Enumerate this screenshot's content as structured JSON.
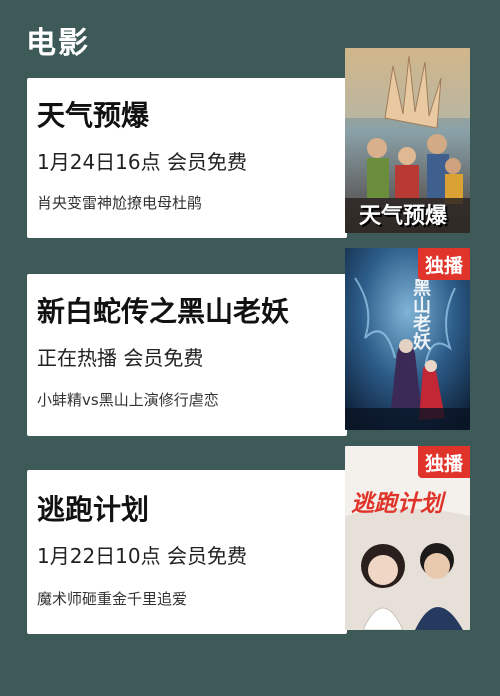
{
  "section": {
    "title": "电影"
  },
  "movies": [
    {
      "title": "天气预爆",
      "schedule": "1月24日16点  会员免费",
      "description": "肖央变雷神尬撩电母杜鹃",
      "poster_text": "天气预爆",
      "badge": ""
    },
    {
      "title": "新白蛇传之黑山老妖",
      "schedule": "正在热播  会员免费",
      "description": "小蚌精vs黑山上演修行虐恋",
      "poster_text": "黑山老妖",
      "badge": "独播"
    },
    {
      "title": "逃跑计划",
      "schedule": "1月22日10点  会员免费",
      "description": "魔术师砸重金千里追爱",
      "poster_text": "逃跑计划",
      "badge": "独播"
    }
  ],
  "colors": {
    "background": "#3e5a58",
    "badge": "#e0342a",
    "card": "#ffffff"
  }
}
